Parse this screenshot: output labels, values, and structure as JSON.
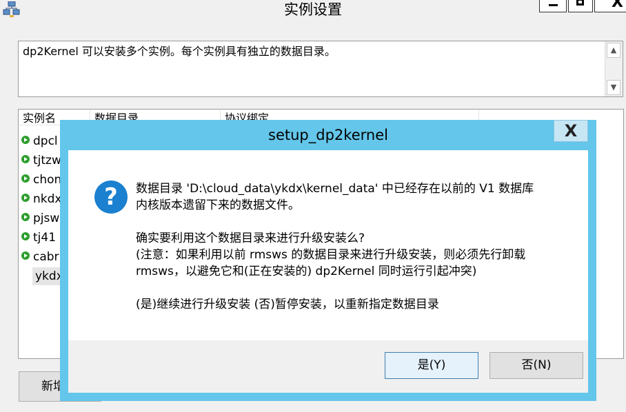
{
  "window": {
    "title": "实例设置",
    "icon": "network-computers-icon",
    "controls": {
      "minimize": "minimize-icon",
      "maximize": "maximize-icon",
      "close_glyph": "X"
    }
  },
  "description": {
    "text": "dp2Kernel 可以安装多个实例。每个实例具有独立的数据目录。"
  },
  "instance_list": {
    "columns": [
      "实例名",
      "数据目录",
      "协议绑定"
    ],
    "rows": [
      {
        "name": "dpcl",
        "status": "running"
      },
      {
        "name": "tjtzw",
        "status": "running"
      },
      {
        "name": "chon",
        "status": "running"
      },
      {
        "name": "nkdx",
        "status": "running"
      },
      {
        "name": "pjsw",
        "status": "running"
      },
      {
        "name": "tj41",
        "status": "running"
      },
      {
        "name": "cabr",
        "status": "running"
      },
      {
        "name": "ykdx",
        "status": "none",
        "selected": true
      }
    ]
  },
  "new_button": {
    "label": "新增"
  },
  "dialog": {
    "title": "setup_dp2kernel",
    "close_glyph": "X",
    "icon": "question-icon",
    "message_lines": [
      "数据目录 'D:\\cloud_data\\ykdx\\kernel_data' 中已经存在以前的 V1 数据库",
      "内核版本遗留下来的数据文件。",
      "",
      "确实要利用这个数据目录来进行升级安装么?",
      "(注意：如果利用以前 rmsws 的数据目录来进行升级安装，则必须先行卸载",
      "rmsws，以避免它和(正在安装的) dp2Kernel 同时运行引起冲突)",
      "",
      "(是)继续进行升级安装 (否)暂停安装，以重新指定数据目录"
    ],
    "yes_label": "是(Y)",
    "no_label": "否(N)"
  },
  "colors": {
    "dialog_frame": "#63c6ea",
    "question_icon": "#1b80cf",
    "status_running": "#2e9e2e"
  }
}
